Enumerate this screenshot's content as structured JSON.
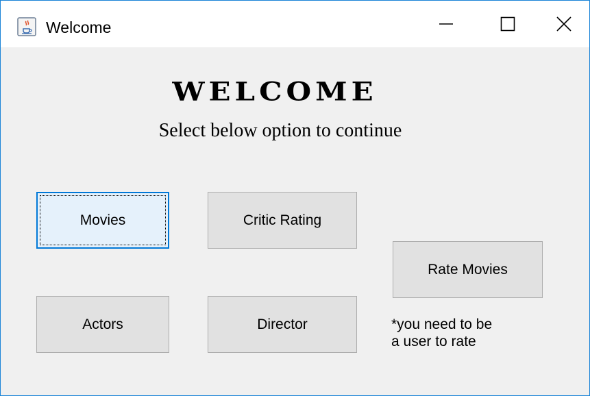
{
  "window": {
    "title": "Welcome",
    "icon": "java-cup-icon",
    "controls": {
      "minimize": "minimize-icon",
      "maximize": "maximize-icon",
      "close": "close-icon"
    },
    "accent_color": "#1883d7"
  },
  "main": {
    "heading": "WELCOME",
    "subtitle": "Select below option to continue",
    "buttons": {
      "movies": "Movies",
      "critic_rating": "Critic Rating",
      "rate_movies": "Rate Movies",
      "actors": "Actors",
      "director": "Director"
    },
    "focused_button": "Movies",
    "note_line1": "*you need to be",
    "note_line2": "a user to rate"
  }
}
